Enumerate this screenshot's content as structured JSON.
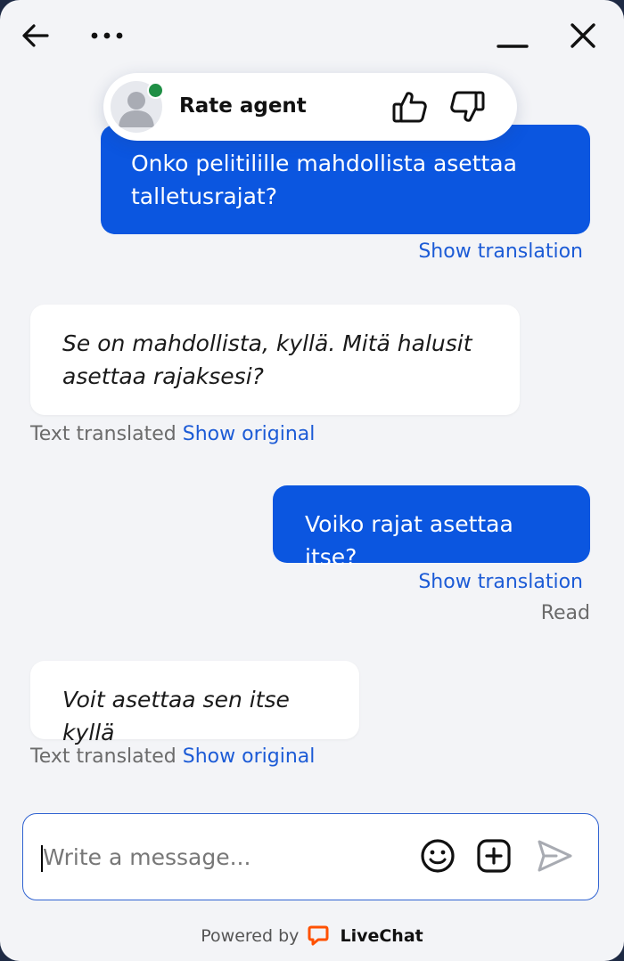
{
  "header": {
    "back_icon": "arrow-left-icon",
    "more_icon": "more-dots-icon",
    "minimize_icon": "minimize-icon",
    "close_icon": "close-icon"
  },
  "rating": {
    "label": "Rate agent",
    "thumb_up_icon": "thumbs-up-icon",
    "thumb_down_icon": "thumbs-down-icon",
    "online_color": "#1f8f45"
  },
  "messages": [
    {
      "sender": "visitor",
      "text": "Onko pelitilille mahdollista asettaa talletusrajat?",
      "action": "Show translation"
    },
    {
      "sender": "agent",
      "text": "Se on mahdollista, kyllä. Mitä halusit asettaa rajaksesi?",
      "note": "Text translated",
      "action": "Show original"
    },
    {
      "sender": "visitor",
      "text": "Voiko rajat asettaa itse?",
      "action": "Show translation",
      "status": "Read"
    },
    {
      "sender": "agent",
      "text": "Voit asettaa sen itse kyllä",
      "note": "Text translated",
      "action": "Show original"
    }
  ],
  "composer": {
    "placeholder": "Write a message...",
    "value": "",
    "emoji_icon": "emoji-icon",
    "attach_icon": "add-attachment-icon",
    "send_icon": "send-icon"
  },
  "footer": {
    "powered_by": "Powered by",
    "brand": "LiveChat",
    "brand_icon": "livechat-logo-icon",
    "brand_color": "#ff5100"
  },
  "colors": {
    "visitor_bubble": "#0b56e0",
    "agent_bubble": "#ffffff",
    "link": "#1c5bd6",
    "background": "#f3f4f7"
  }
}
